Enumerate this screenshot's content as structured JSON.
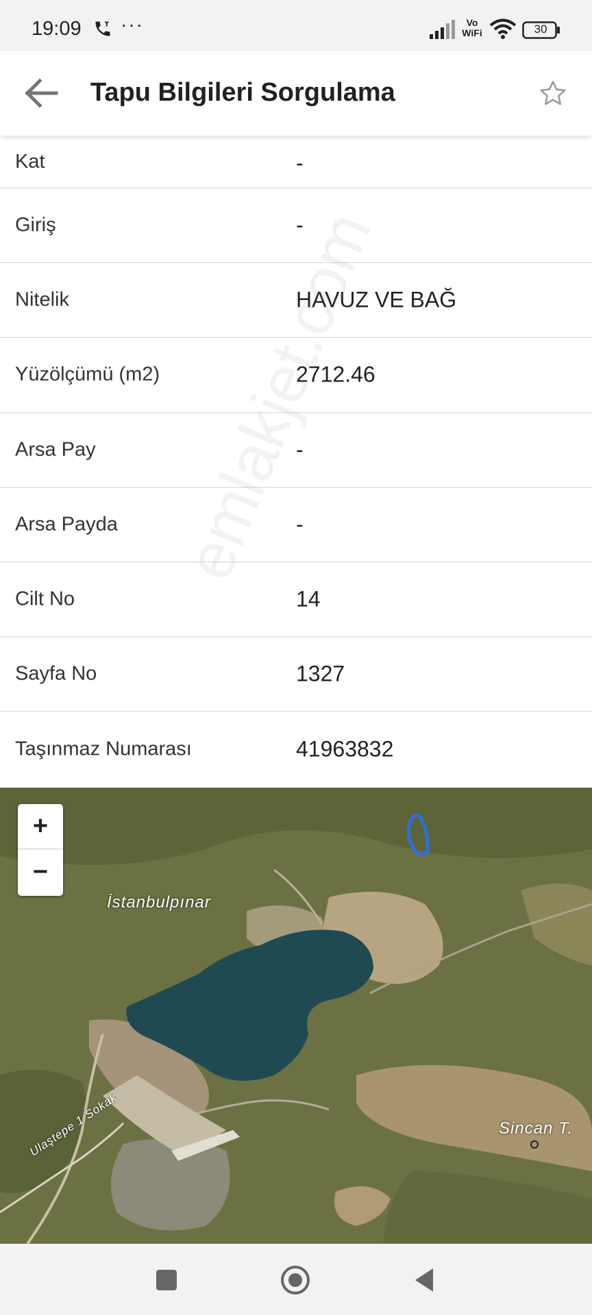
{
  "status_bar": {
    "time": "19:09",
    "dots": "···",
    "vowifi": "Vo WiFi",
    "battery": "30",
    "icons": [
      "call-icon",
      "signal-icon",
      "wifi-icon",
      "battery-icon"
    ]
  },
  "app_bar": {
    "title": "Tapu Bilgileri Sorgulama",
    "back_icon": "arrow-left-icon",
    "favorite_icon": "star-outline-icon"
  },
  "info": {
    "rows": [
      {
        "label": "Kat",
        "value": "-"
      },
      {
        "label": "Giriş",
        "value": "-"
      },
      {
        "label": "Nitelik",
        "value": "HAVUZ VE BAĞ"
      },
      {
        "label": "Yüzölçümü (m2)",
        "value": "2712.46"
      },
      {
        "label": "Arsa Pay",
        "value": "-"
      },
      {
        "label": "Arsa Payda",
        "value": "-"
      },
      {
        "label": "Cilt No",
        "value": "14"
      },
      {
        "label": "Sayfa No",
        "value": "1327"
      },
      {
        "label": "Taşınmaz Numarası",
        "value": "41963832"
      }
    ]
  },
  "watermark": "emlakjet.com",
  "map": {
    "zoom_in": "+",
    "zoom_out": "−",
    "labels": {
      "istanbulpinar": "İstanbulpınar",
      "sincan": "Sincan T.",
      "street": "Ulaştepe 1 Sokak"
    },
    "parcel_color": "#2d6fe0",
    "water_color": "#1f4a52"
  },
  "nav_bar": {
    "icons": [
      "recents-square-icon",
      "home-circle-icon",
      "back-triangle-icon"
    ]
  }
}
